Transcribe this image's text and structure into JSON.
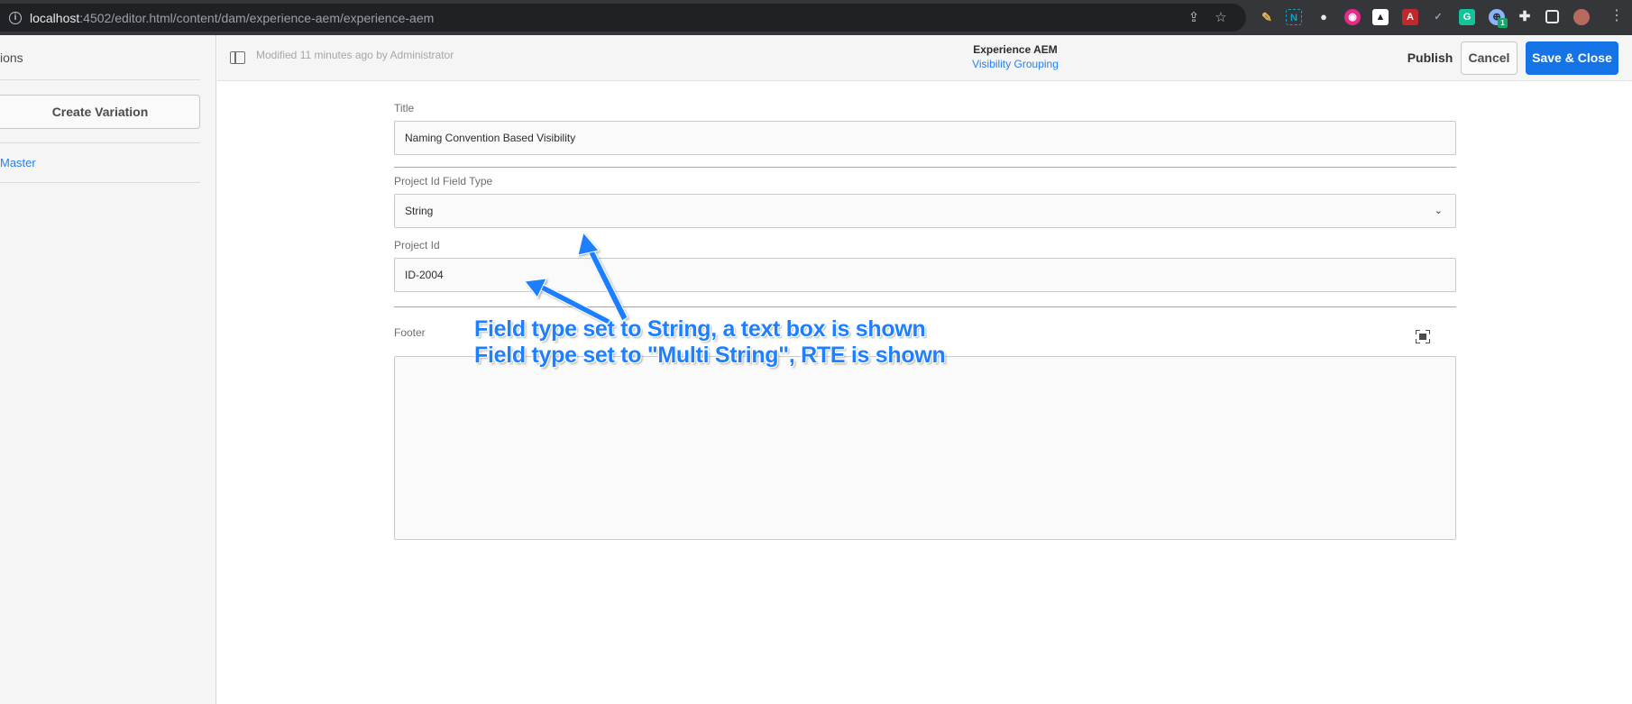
{
  "browser": {
    "url_host": "localhost",
    "url_rest": ":4502/editor.html/content/dam/experience-aem/experience-aem",
    "extension_badge": "1"
  },
  "sidebar": {
    "title": "ions",
    "create_variation_label": "Create Variation",
    "variations": [
      {
        "label": "Master"
      }
    ]
  },
  "header": {
    "modified_text": "Modified 11 minutes ago by Administrator",
    "title": "Experience AEM",
    "subtitle": "Visibility Grouping",
    "publish_label": "Publish",
    "cancel_label": "Cancel",
    "save_close_label": "Save & Close"
  },
  "form": {
    "title_label": "Title",
    "title_value": "Naming Convention Based Visibility",
    "field_type_label": "Project Id Field Type",
    "field_type_value": "String",
    "project_id_label": "Project Id",
    "project_id_value": "ID-2004",
    "footer_label": "Footer"
  },
  "annotation": {
    "line1": "Field type set to String, a text box is shown",
    "line2": "Field type set to \"Multi String\", RTE is shown"
  },
  "colors": {
    "accent": "#1473e6",
    "link": "#2680eb",
    "annotation": "#1e7fff"
  }
}
